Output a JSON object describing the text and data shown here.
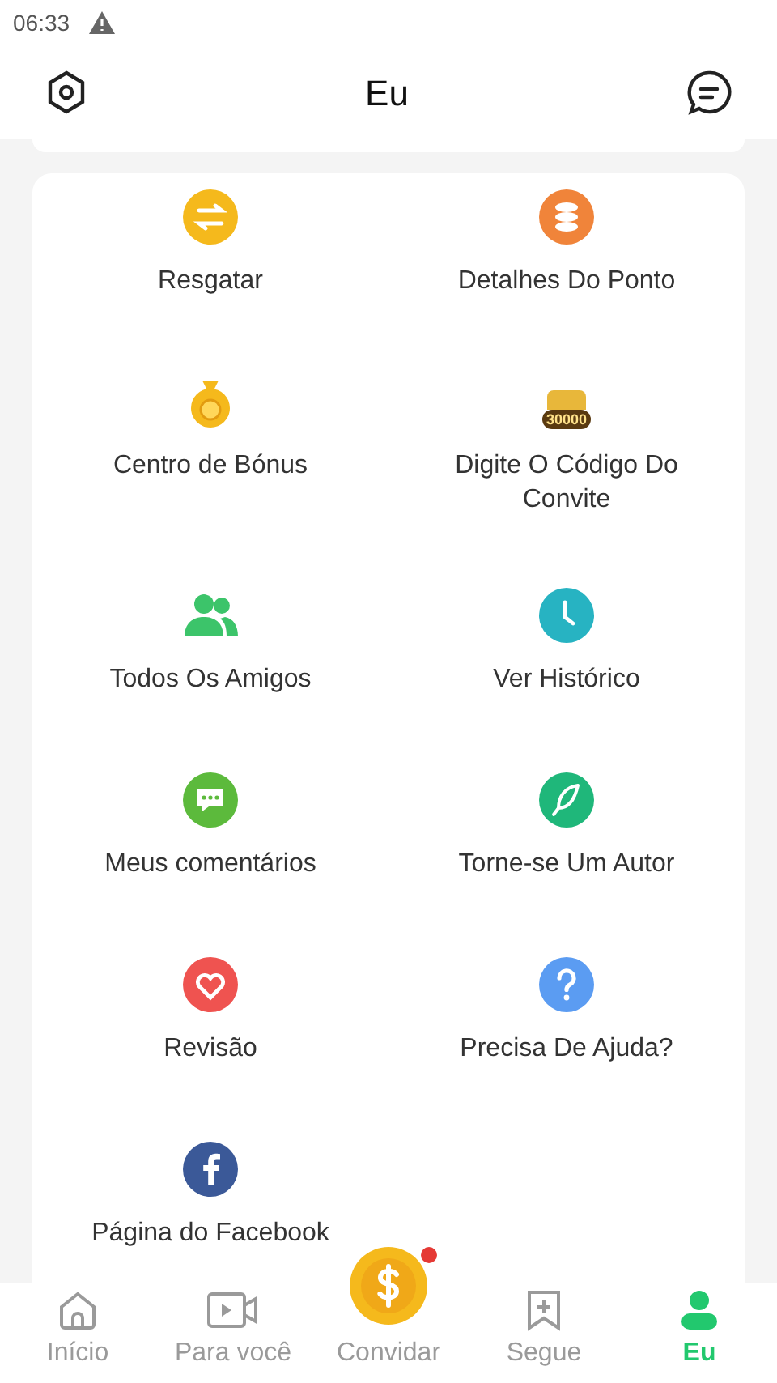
{
  "status_bar": {
    "time": "06:33"
  },
  "header": {
    "title": "Eu"
  },
  "menu_rows": [
    {
      "items": [
        {
          "label": "Resgatar",
          "kind": "swap",
          "color": "#f5b91c"
        },
        {
          "label": "Detalhes Do Ponto",
          "kind": "coins",
          "color": "#f0843a"
        }
      ]
    },
    {
      "items": [
        {
          "label": "Centro de Bónus",
          "kind": "bag",
          "color": "#f5b91c"
        },
        {
          "label": "Digite O Código Do Convite",
          "kind": "gift",
          "color": "#e8b73a",
          "badge": "30000"
        }
      ]
    },
    {
      "items": [
        {
          "label": "Todos Os Amigos",
          "kind": "people",
          "color": "#3cc46a"
        },
        {
          "label": "Ver Histórico",
          "kind": "clock",
          "color": "#27b3c2"
        }
      ]
    },
    {
      "items": [
        {
          "label": "Meus comentários",
          "kind": "chat",
          "color": "#5cba3c"
        },
        {
          "label": "Torne-se Um Autor",
          "kind": "pen",
          "color": "#1fb77a"
        }
      ]
    },
    {
      "items": [
        {
          "label": "Revisão",
          "kind": "heart",
          "color": "#ef5350"
        },
        {
          "label": "Precisa De Ajuda?",
          "kind": "help",
          "color": "#5b9cf2"
        }
      ]
    },
    {
      "items": [
        {
          "label": "Página do Facebook",
          "kind": "facebook",
          "color": "#3b5998"
        }
      ]
    }
  ],
  "nav": [
    {
      "label": "Início",
      "kind": "home",
      "selected": false
    },
    {
      "label": "Para você",
      "kind": "video",
      "selected": false
    },
    {
      "label": "Convidar",
      "kind": "coin",
      "selected": false,
      "notification": true
    },
    {
      "label": "Segue",
      "kind": "bookmark",
      "selected": false
    },
    {
      "label": "Eu",
      "kind": "person",
      "selected": true
    }
  ]
}
